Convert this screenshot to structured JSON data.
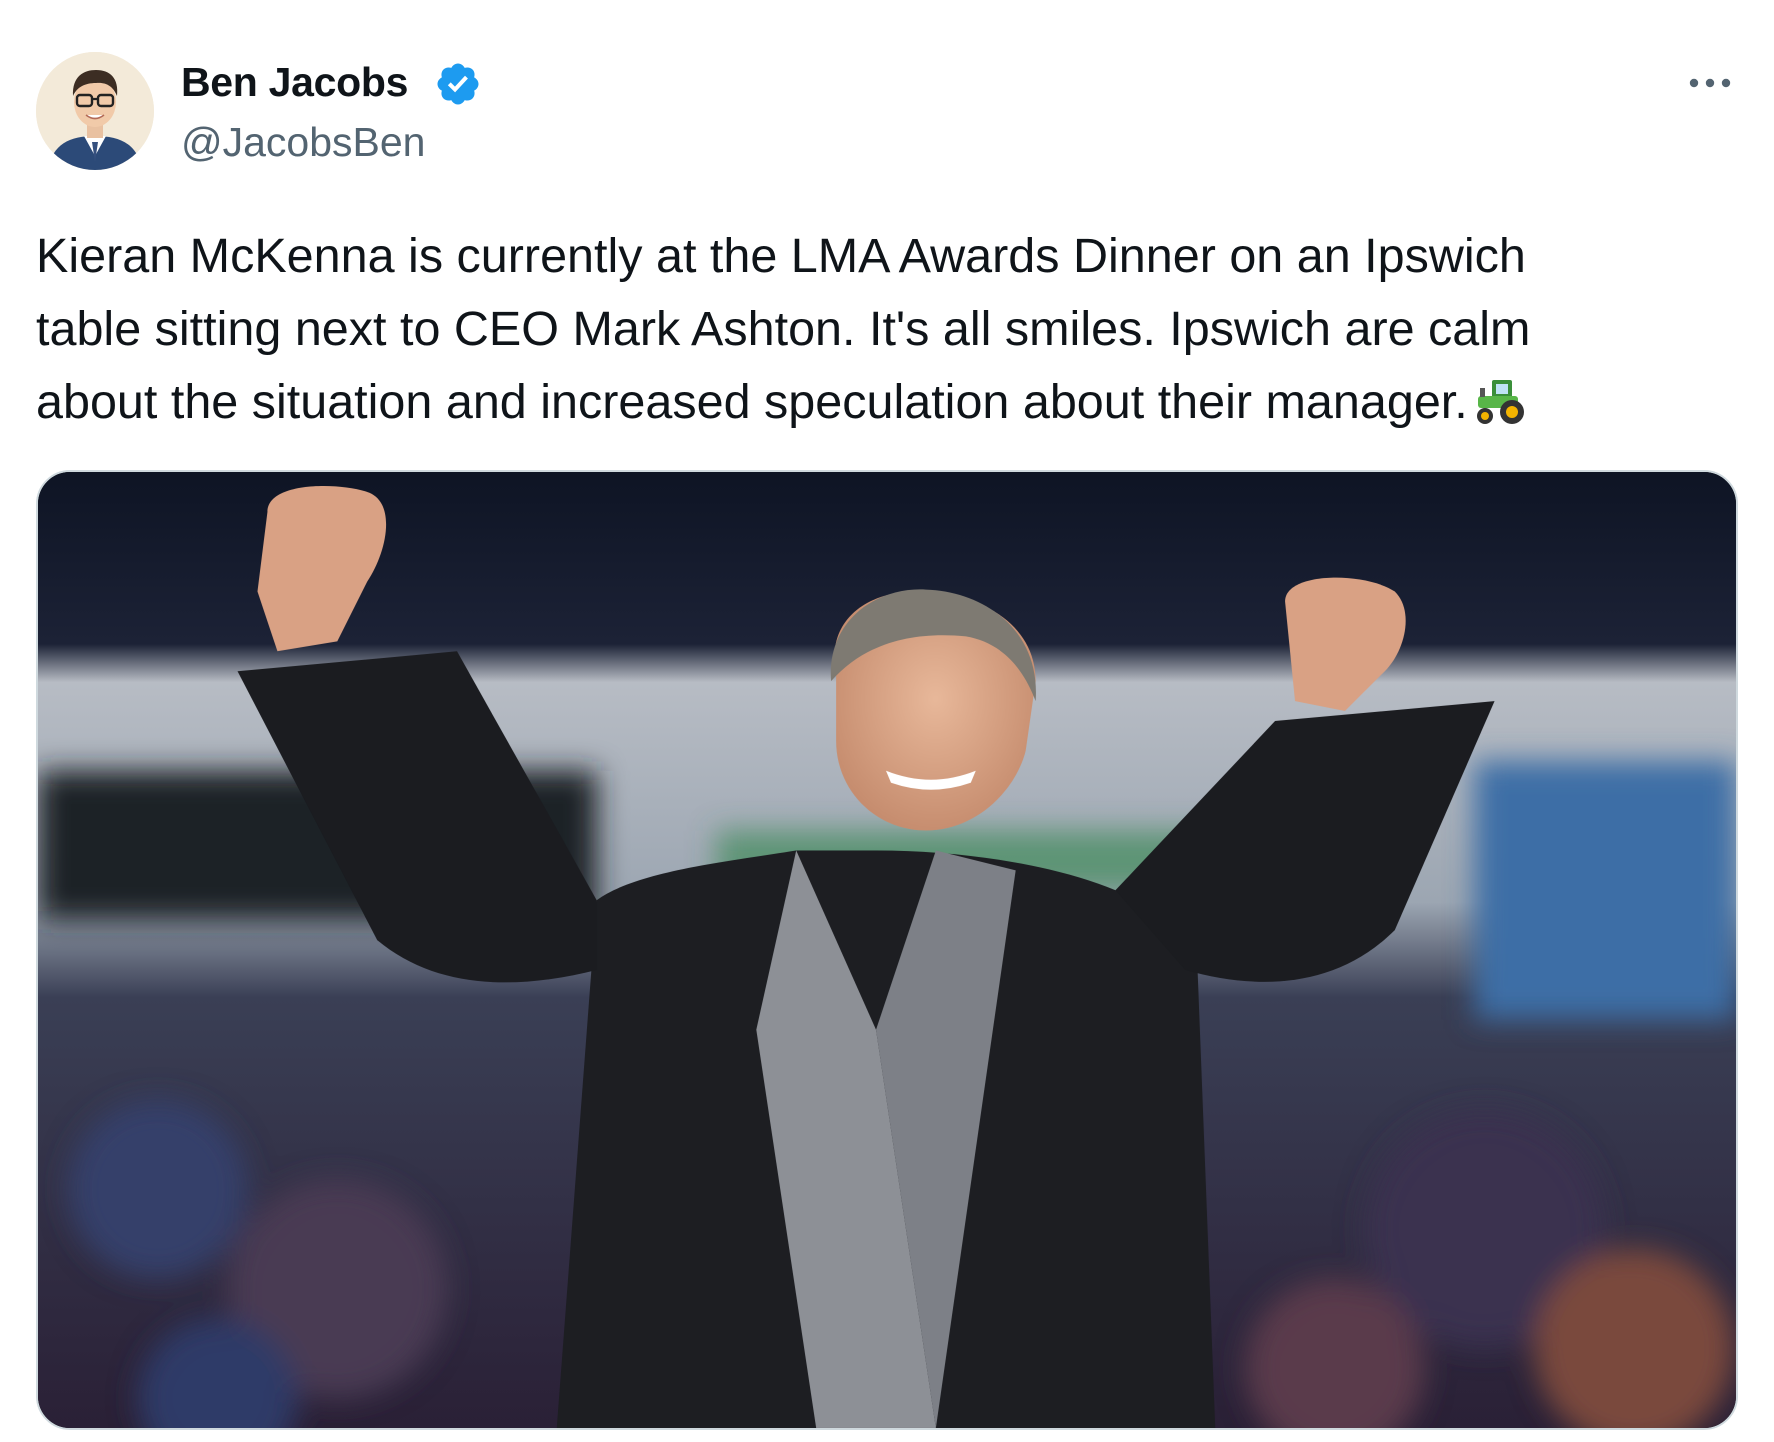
{
  "author": {
    "name": "Ben Jacobs",
    "handle": "@JacobsBen",
    "verified": true,
    "avatar_icon": "profile-avatar"
  },
  "more_icon": "ellipsis-icon",
  "tweet": {
    "lines": [
      "Kieran McKenna is currently at the LMA Awards Dinner on an Ipswich",
      "table sitting next to CEO Mark Ashton. It's all smiles. Ipswich are calm",
      "about the situation and increased speculation about their manager."
    ],
    "emoji": "tractor"
  },
  "media": {
    "type": "photo",
    "icon": "photo-celebrating-manager"
  },
  "colors": {
    "text": "#0f1419",
    "secondary": "#536471",
    "verified": "#1d9bf0",
    "border": "#cfd9de"
  }
}
